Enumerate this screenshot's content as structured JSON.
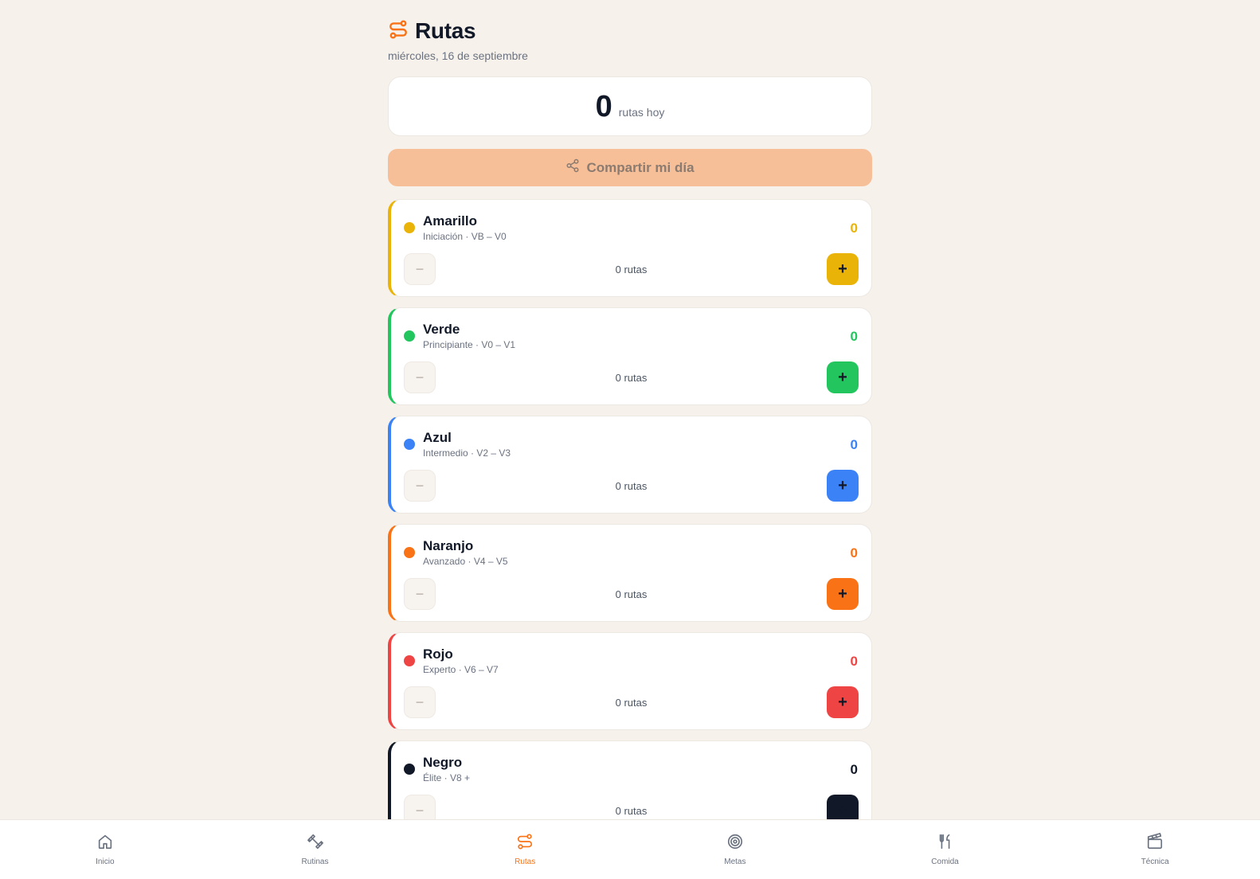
{
  "header": {
    "title": "Rutas",
    "date": "miércoles, 16 de septiembre",
    "icon": "route-icon",
    "accent": "#f97316"
  },
  "summary": {
    "count": "0",
    "label": "rutas hoy"
  },
  "share": {
    "label": "Compartir mi día",
    "icon": "share-icon"
  },
  "grades": [
    {
      "name": "Amarillo",
      "sub": "Iniciación · VB – V0",
      "count": "0",
      "routes": "0 rutas",
      "color": "#eab308",
      "plus": "+"
    },
    {
      "name": "Verde",
      "sub": "Principiante · V0 – V1",
      "count": "0",
      "routes": "0 rutas",
      "color": "#22c55e",
      "plus": "+"
    },
    {
      "name": "Azul",
      "sub": "Intermedio · V2 – V3",
      "count": "0",
      "routes": "0 rutas",
      "color": "#3b82f6",
      "plus": "+"
    },
    {
      "name": "Naranjo",
      "sub": "Avanzado · V4 – V5",
      "count": "0",
      "routes": "0 rutas",
      "color": "#f97316",
      "plus": "+"
    },
    {
      "name": "Rojo",
      "sub": "Experto · V6 – V7",
      "count": "0",
      "routes": "0 rutas",
      "color": "#ef4444",
      "plus": "+"
    },
    {
      "name": "Negro",
      "sub": "Élite · V8 +",
      "count": "0",
      "routes": "0 rutas",
      "color": "#111827",
      "plus": "+"
    }
  ],
  "nav": [
    {
      "label": "Inicio",
      "icon": "home-icon"
    },
    {
      "label": "Rutinas",
      "icon": "dumbbell-icon"
    },
    {
      "label": "Rutas",
      "icon": "route-icon",
      "active": true
    },
    {
      "label": "Metas",
      "icon": "target-icon"
    },
    {
      "label": "Comida",
      "icon": "utensils-icon"
    },
    {
      "label": "Técnica",
      "icon": "clapperboard-icon"
    }
  ]
}
